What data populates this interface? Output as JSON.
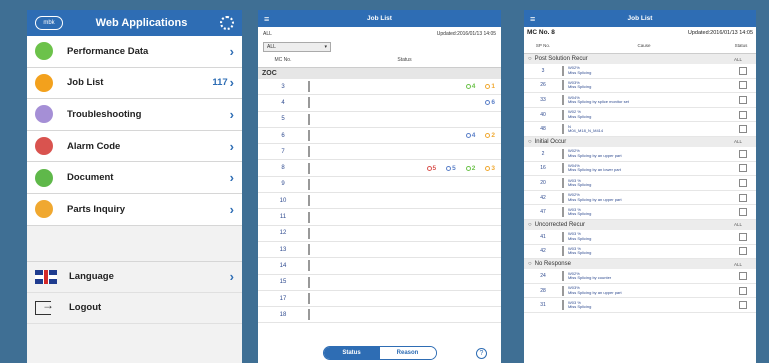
{
  "screen1": {
    "logo": "mbk",
    "title": "Web Applications",
    "menu": [
      {
        "label": "Performance Data",
        "color": "#6cc24a",
        "count": ""
      },
      {
        "label": "Job List",
        "color": "#f3a11d",
        "count": "117"
      },
      {
        "label": "Troubleshooting",
        "color": "#a58fd6",
        "count": ""
      },
      {
        "label": "Alarm Code",
        "color": "#d9534f",
        "count": ""
      },
      {
        "label": "Document",
        "color": "#5fb84a",
        "count": ""
      },
      {
        "label": "Parts Inquiry",
        "color": "#f0a830",
        "count": ""
      }
    ],
    "language_label": "Language",
    "logout_label": "Logout"
  },
  "screen2": {
    "title": "Job List",
    "sub_left": "ALL",
    "sub_right": "Updated:2016/01/13 14:05",
    "select_value": "ALL",
    "col_mc": "MC No.",
    "col_status": "Status",
    "group": "ZOC",
    "rows": [
      {
        "num": "3",
        "s": [
          "",
          "",
          "4",
          "1"
        ]
      },
      {
        "num": "4",
        "s": [
          "",
          "6",
          "",
          ""
        ]
      },
      {
        "num": "5",
        "s": [
          "",
          "",
          "",
          ""
        ]
      },
      {
        "num": "6",
        "s": [
          "",
          "4",
          "",
          "2"
        ]
      },
      {
        "num": "7",
        "s": [
          "",
          "",
          "",
          ""
        ]
      },
      {
        "num": "8",
        "s": [
          "5",
          "5",
          "2",
          "3"
        ]
      },
      {
        "num": "9",
        "s": [
          "",
          "",
          "",
          ""
        ]
      },
      {
        "num": "10",
        "s": [
          "",
          "",
          "",
          ""
        ]
      },
      {
        "num": "11",
        "s": [
          "",
          "",
          "",
          ""
        ]
      },
      {
        "num": "12",
        "s": [
          "",
          "",
          "",
          ""
        ]
      },
      {
        "num": "13",
        "s": [
          "",
          "",
          "",
          ""
        ]
      },
      {
        "num": "14",
        "s": [
          "",
          "",
          "",
          ""
        ]
      },
      {
        "num": "15",
        "s": [
          "",
          "",
          "",
          ""
        ]
      },
      {
        "num": "17",
        "s": [
          "",
          "",
          "",
          ""
        ]
      },
      {
        "num": "18",
        "s": [
          "",
          "",
          "",
          ""
        ]
      }
    ],
    "status_colors": [
      "#d9534f",
      "#5a7fc8",
      "#6cc24a",
      "#f0a830"
    ],
    "tab_status": "Status",
    "tab_reason": "Reason",
    "help": "?"
  },
  "screen3": {
    "title": "Job List",
    "mc_label": "MC No. 8",
    "updated": "Updated:2016/01/13 14:05",
    "col_num": "SP No.",
    "col_cause": "Cause",
    "col_status": "Status",
    "all_label": "ALL",
    "groups": [
      {
        "name": "Post Solution Recur",
        "rows": [
          {
            "n": "3",
            "l1": "W02%",
            "l2": "Miss Splicing"
          },
          {
            "n": "26",
            "l1": "W03%",
            "l2": "Miss Splicing"
          },
          {
            "n": "33",
            "l1": "W04%",
            "l2": "Miss Splicing by splice monitor set"
          },
          {
            "n": "40",
            "l1": "W02 %",
            "l2": "Miss Splicing"
          },
          {
            "n": "48",
            "l1": "N",
            "l2": "M04_M18_N_M414"
          }
        ]
      },
      {
        "name": "Initial Occur",
        "rows": [
          {
            "n": "2",
            "l1": "W02%",
            "l2": "Miss Splicing by an upper part"
          },
          {
            "n": "16",
            "l1": "W04%",
            "l2": "Miss Splicing by an lower part"
          },
          {
            "n": "20",
            "l1": "W03 %",
            "l2": "Miss Splicing"
          },
          {
            "n": "42",
            "l1": "W02%",
            "l2": "Miss Splicing by an upper part"
          },
          {
            "n": "47",
            "l1": "W03 %",
            "l2": "Miss Splicing"
          }
        ]
      },
      {
        "name": "Uncorrected Recur",
        "rows": [
          {
            "n": "41",
            "l1": "W03 %",
            "l2": "Miss Splicing"
          },
          {
            "n": "42",
            "l1": "W03 %",
            "l2": "Miss Splicing"
          }
        ]
      },
      {
        "name": "No Response",
        "rows": [
          {
            "n": "24",
            "l1": "W02%",
            "l2": "Miss Splicing by counter"
          },
          {
            "n": "28",
            "l1": "W03%",
            "l2": "Miss Splicing by an upper part"
          },
          {
            "n": "31",
            "l1": "W03 %",
            "l2": "Miss Splicing"
          }
        ]
      }
    ]
  }
}
